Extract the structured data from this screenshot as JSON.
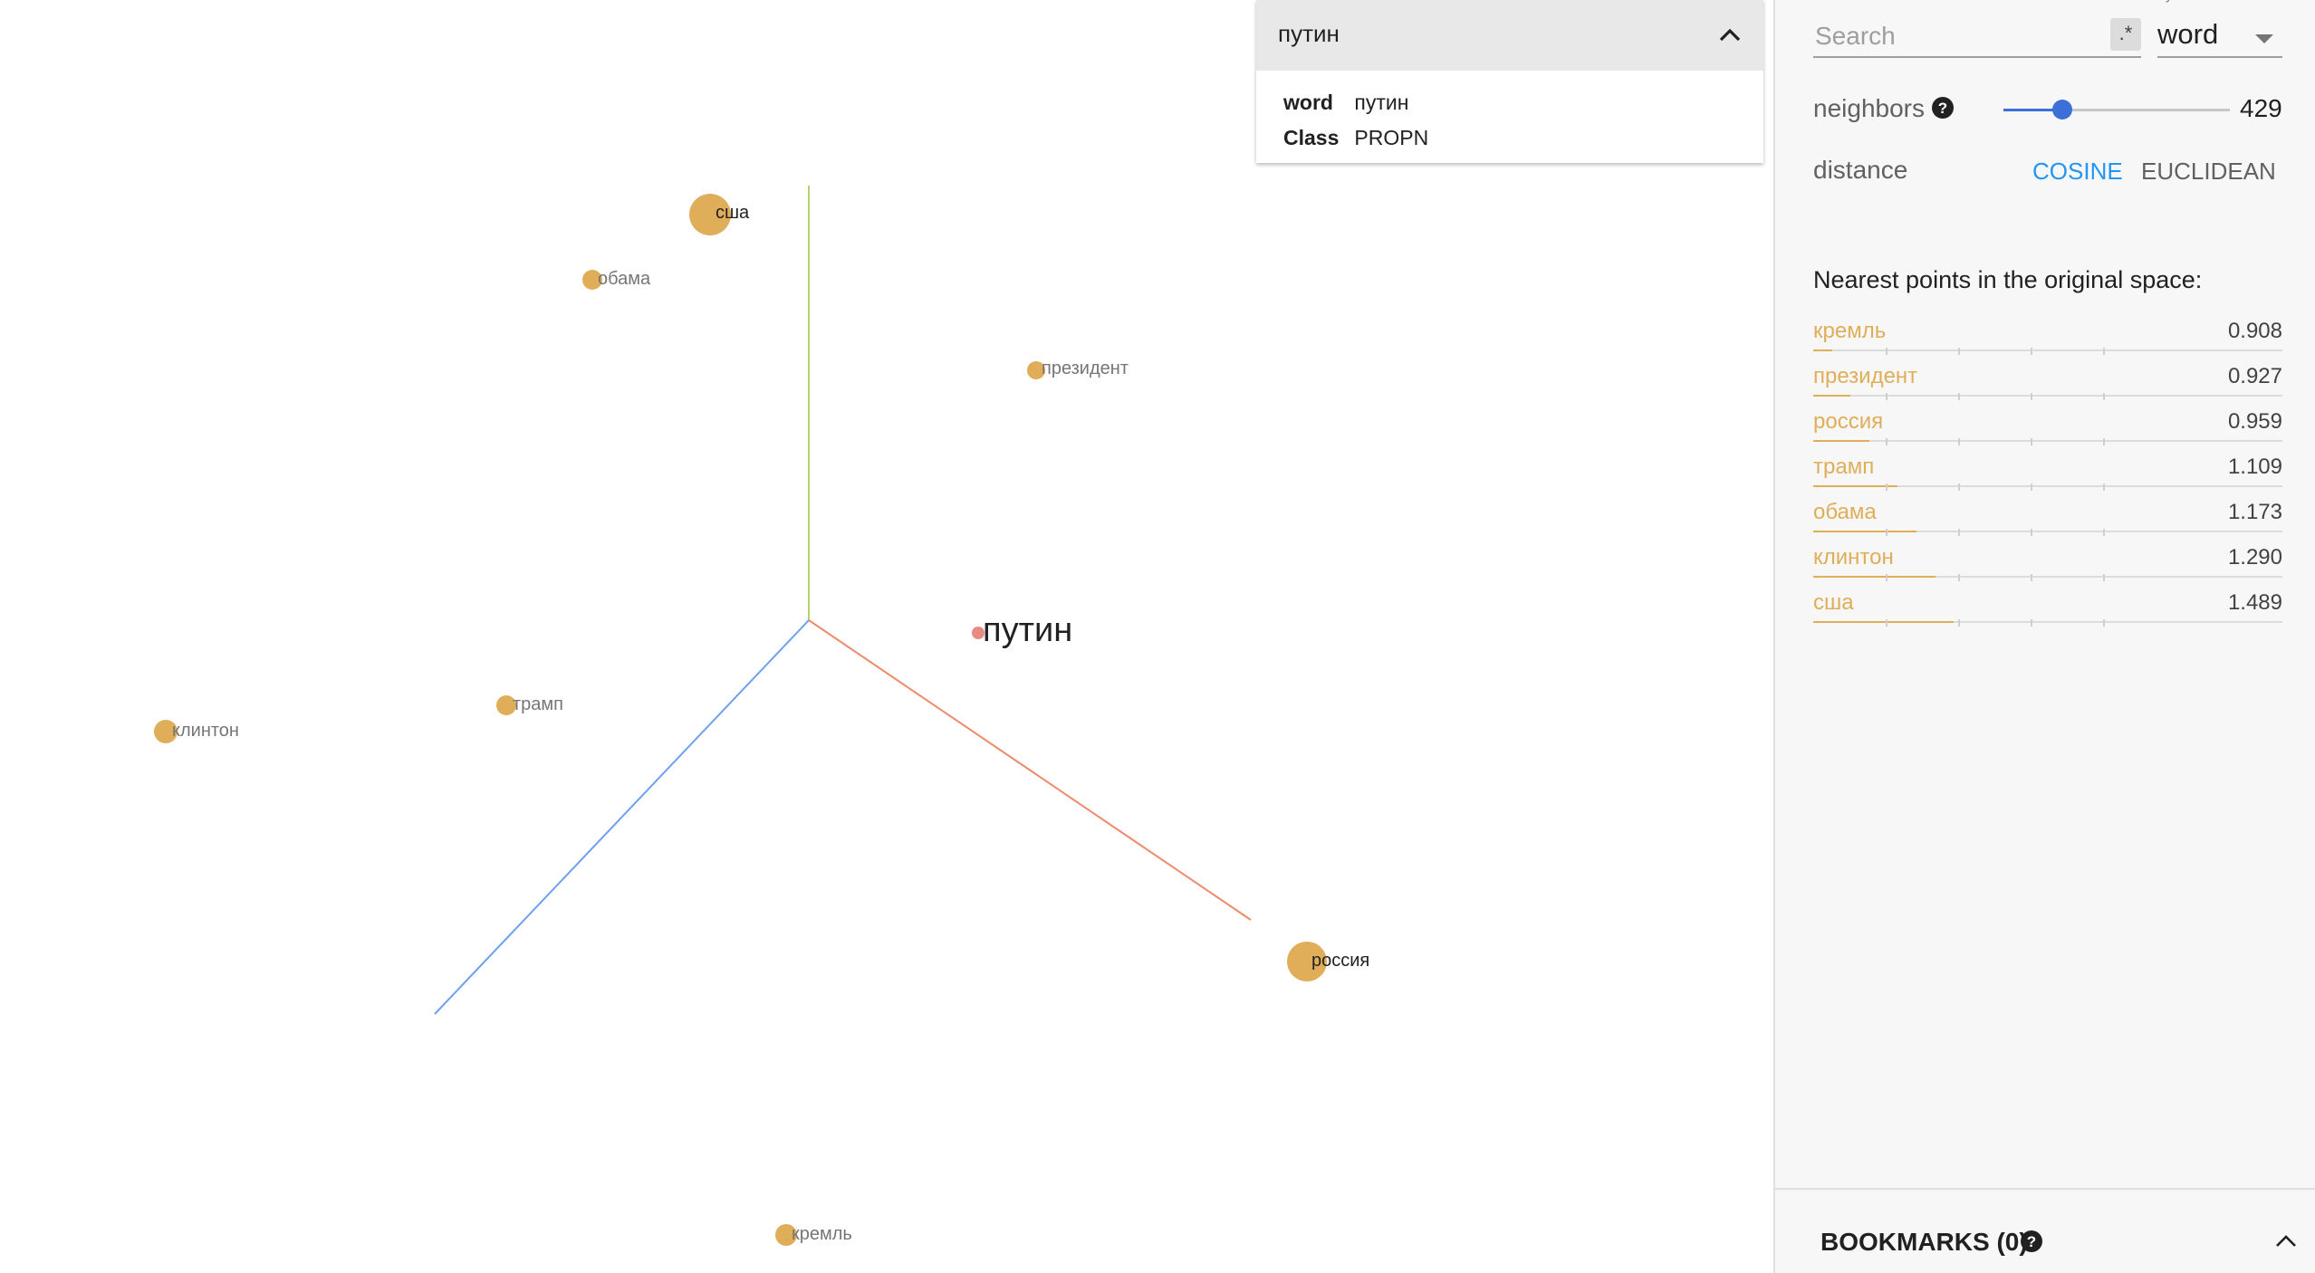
{
  "plot": {
    "focus_point": {
      "label": "путин"
    },
    "points": [
      {
        "label": "сша"
      },
      {
        "label": "обама"
      },
      {
        "label": "президент"
      },
      {
        "label": "клинтон"
      },
      {
        "label": "трамп"
      },
      {
        "label": "россия"
      },
      {
        "label": "кремль"
      }
    ],
    "point_color": "#e0ad58",
    "focus_color": "#e98a84"
  },
  "info_card": {
    "title": "путин",
    "fields": [
      {
        "key": "word",
        "value": "путин"
      },
      {
        "key": "Class",
        "value": "PROPN"
      }
    ]
  },
  "panel": {
    "by_label": "by",
    "search_placeholder": "Search",
    "regex_label": ".*",
    "by_value": "word",
    "neighbors_label": "neighbors",
    "neighbors_value": "429",
    "neighbors_fraction": 0.26,
    "distance_label": "distance",
    "distance_options": [
      "COSINE",
      "EUCLIDEAN"
    ],
    "distance_selected": "COSINE",
    "nearest_title": "Nearest points in the original space:",
    "nearest": [
      {
        "word": "кремль",
        "value": "0.908"
      },
      {
        "word": "президент",
        "value": "0.927"
      },
      {
        "word": "россия",
        "value": "0.959"
      },
      {
        "word": "трамп",
        "value": "1.109"
      },
      {
        "word": "обама",
        "value": "1.173"
      },
      {
        "word": "клинтон",
        "value": "1.290"
      },
      {
        "word": "сша",
        "value": "1.489"
      }
    ],
    "bookmarks_label": "BOOKMARKS (0)"
  },
  "colors": {
    "accent": "#2196f3",
    "slider": "#3d6fd9",
    "neighbor": "#e0ad58"
  }
}
